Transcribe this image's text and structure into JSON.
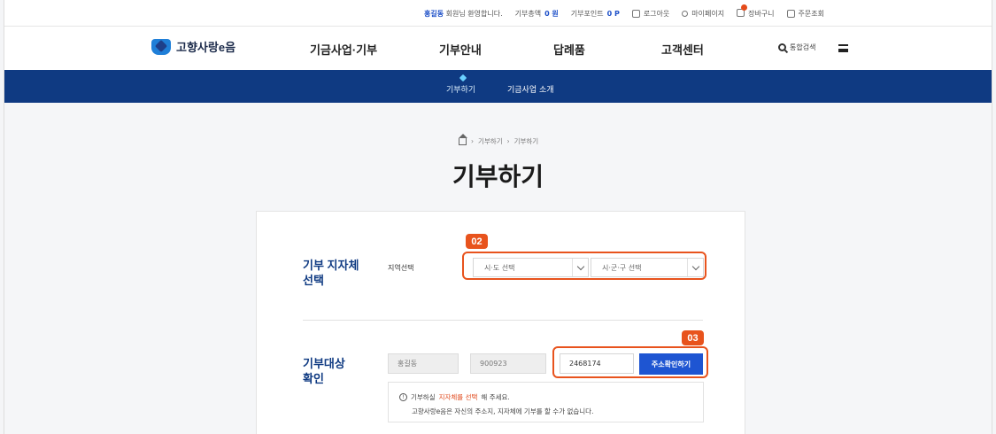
{
  "topbar": {
    "user_name": "홍길동",
    "greeting": "회원님 환영합니다.",
    "donation_total_label": "기부총액",
    "donation_total_value": "0 원",
    "donation_point_label": "기부포인트",
    "donation_point_value": "0 P",
    "logout": "로그아웃",
    "mypage": "마이페이지",
    "cart": "장바구니",
    "orders": "주문조회"
  },
  "nav": {
    "logo": "고향사랑e음",
    "menu": [
      "기금사업·기부",
      "기부안내",
      "답례품",
      "고객센터"
    ],
    "search": "통합검색"
  },
  "subnav": {
    "tabs": [
      "기부하기",
      "기금사업 소개"
    ]
  },
  "breadcrumb": [
    "기부하기",
    "기부하기"
  ],
  "page_title": "기부하기",
  "form": {
    "region_section_label_1": "기부 지자체",
    "region_section_label_2": "선택",
    "region_field_label": "지역선택",
    "sido_select": "시·도 선택",
    "sigungu_select": "시·군·구 선택",
    "target_section_label_1": "기부대상",
    "target_section_label_2": "확인",
    "name_value": "홍길동",
    "birth_value": "900923",
    "postcode_value": "2468174",
    "address_check_button": "주소확인하기",
    "notice_pre": "기부하실",
    "notice_highlight": "지자체를 선택",
    "notice_post": "해 주세요.",
    "notice_line2": "고향사랑e음은 자신의 주소지, 지자체에 기부를 할 수가 없습니다."
  },
  "callouts": [
    "02",
    "03"
  ],
  "colors": {
    "brand_navy": "#0f3a82",
    "accent_orange": "#e8531d",
    "button_blue": "#1e55d2"
  }
}
